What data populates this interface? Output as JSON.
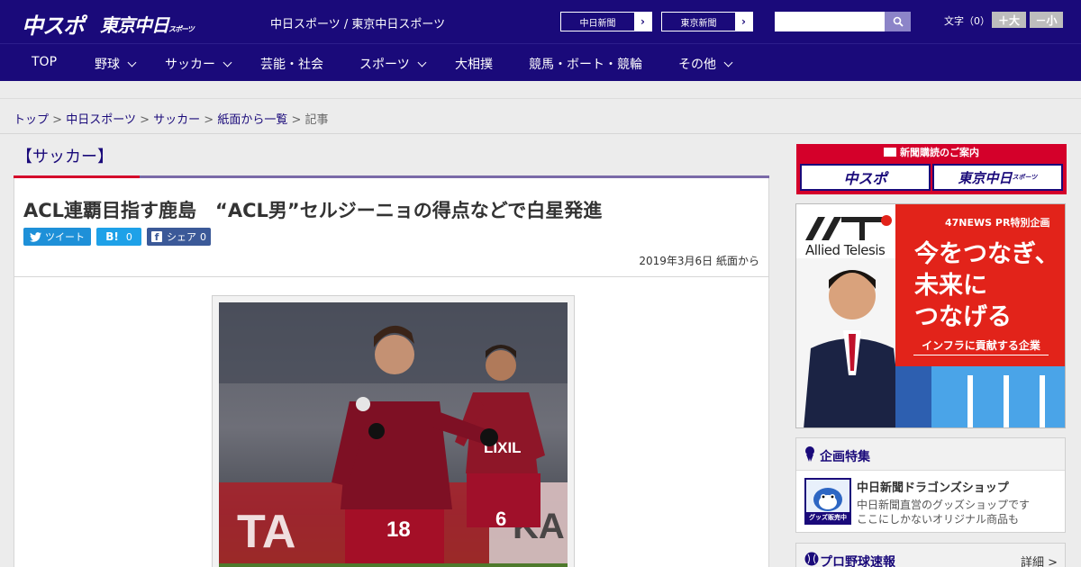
{
  "header": {
    "logo_main": "中スポ",
    "logo_tokyo": "東京中日",
    "logo_tokyo_small": "スポーツ",
    "site_names": "中日スポーツ / 東京中日スポーツ",
    "paper_links": [
      {
        "label": "中日新聞"
      },
      {
        "label": "東京新聞"
      }
    ],
    "search": {
      "placeholder": "",
      "value": ""
    },
    "font_size_label": "文字（0）",
    "font_larger": "＋大",
    "font_smaller": "－小"
  },
  "nav": {
    "items": [
      {
        "label": "TOP"
      },
      {
        "label": "野球"
      },
      {
        "label": "サッカー"
      },
      {
        "label": "芸能・社会"
      },
      {
        "label": "スポーツ"
      },
      {
        "label": "大相撲"
      },
      {
        "label": "競馬・ボート・競輪"
      },
      {
        "label": "その他"
      }
    ]
  },
  "breadcrumb": {
    "items": [
      "トップ",
      "中日スポーツ",
      "サッカー",
      "紙面から一覧"
    ],
    "separator": ">",
    "current": "記事"
  },
  "section": {
    "title": "【サッカー】"
  },
  "article": {
    "title": "ACL連覇目指す鹿島　“ACL男”セルジーニョの得点などで白星発進",
    "date": "2019年3月6日 紙面から",
    "share": {
      "tweet_label": "ツイート",
      "hatena_label": "B!",
      "hatena_count": "0",
      "facebook_label": "シェア",
      "facebook_count": "0"
    },
    "photo_numbers": {
      "left_player": "18",
      "right_player": "6"
    },
    "photo_sponsor": "LIXIL"
  },
  "sidebar": {
    "subscription": {
      "heading": "新聞購読のご案内",
      "left": "中スポ",
      "right": "東京中日",
      "right_small": "スポーツ"
    },
    "ad": {
      "brand": "Allied Telesis",
      "pr_label": "47NEWS PR特別企画",
      "line1": "今をつなぎ、",
      "line2": "未来に",
      "line3": "つなげる",
      "sub": "インフラに貢献する企業"
    },
    "feature": {
      "title": "企画特集",
      "item_title": "中日新聞ドラゴンズショップ",
      "item_desc1": "中日新聞直営のグッズショップです",
      "item_desc2": "ここにしかないオリジナル商品も",
      "thumb_label": "グッズ販売中"
    },
    "baseball": {
      "title": "プロ野球速報",
      "more": "詳細 >"
    }
  },
  "colors": {
    "brand_navy": "#1a0a7a",
    "accent_red": "#d4002a",
    "twitter": "#1e90d8",
    "hatena": "#1ea1e8",
    "facebook": "#3b5998"
  }
}
